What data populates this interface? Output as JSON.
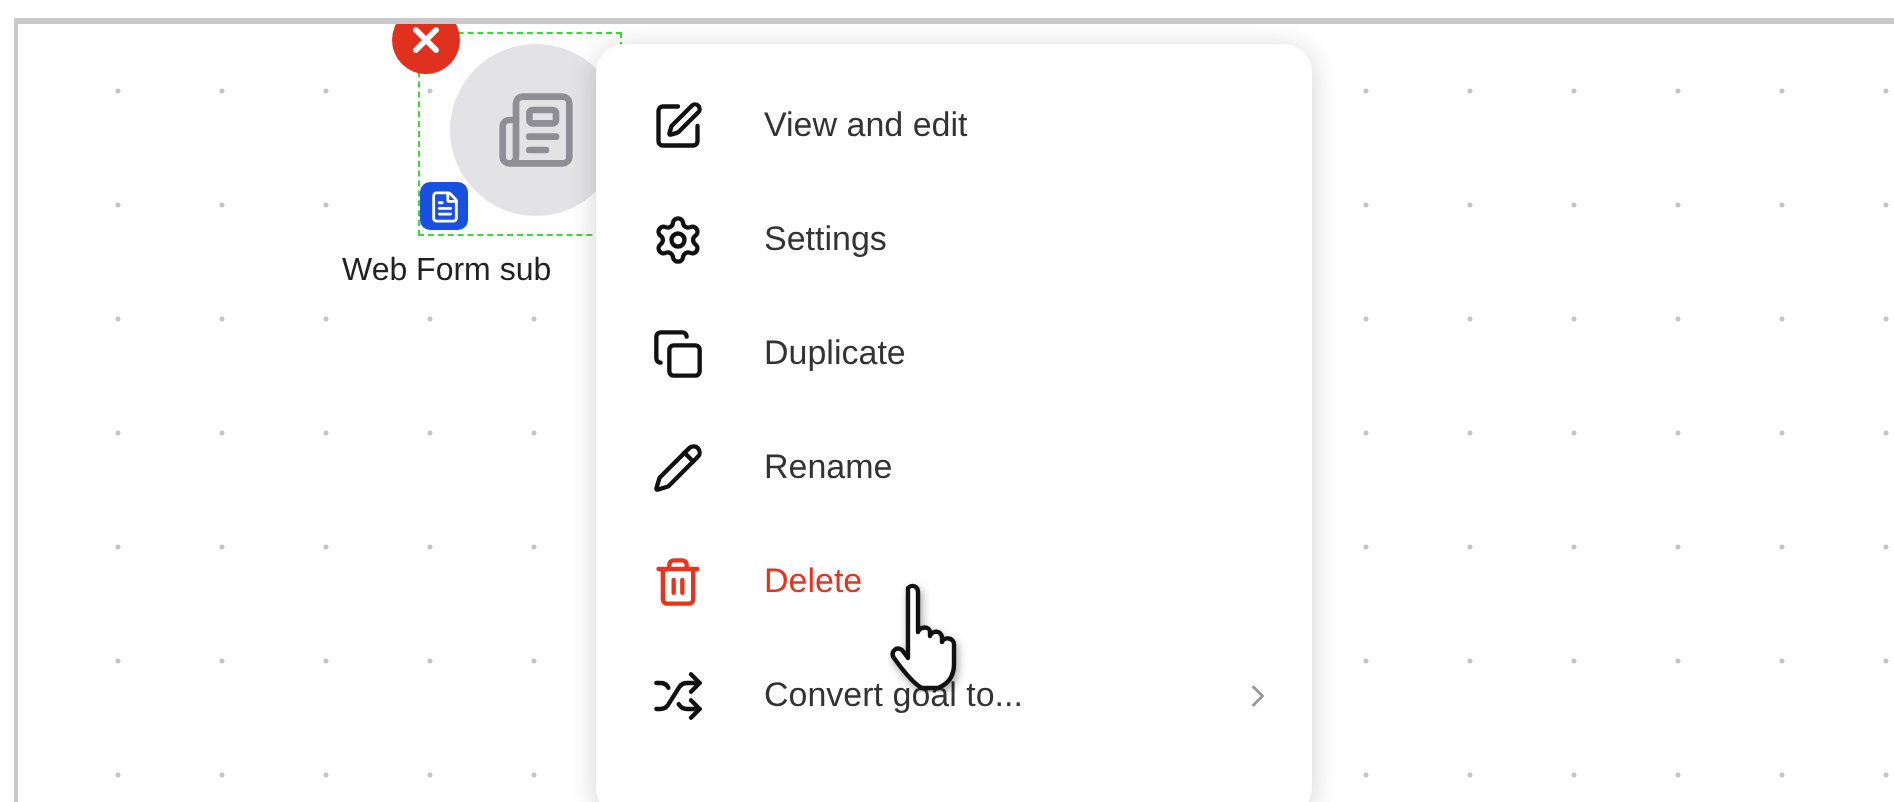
{
  "canvas": {
    "node": {
      "label": "Web Form sub",
      "selected": true
    }
  },
  "context_menu": {
    "items": [
      {
        "label": "View and edit",
        "kind": "normal"
      },
      {
        "label": "Settings",
        "kind": "normal"
      },
      {
        "label": "Duplicate",
        "kind": "normal"
      },
      {
        "label": "Rename",
        "kind": "normal"
      },
      {
        "label": "Delete",
        "kind": "danger"
      },
      {
        "label": "Convert goal to...",
        "kind": "submenu"
      }
    ]
  }
}
